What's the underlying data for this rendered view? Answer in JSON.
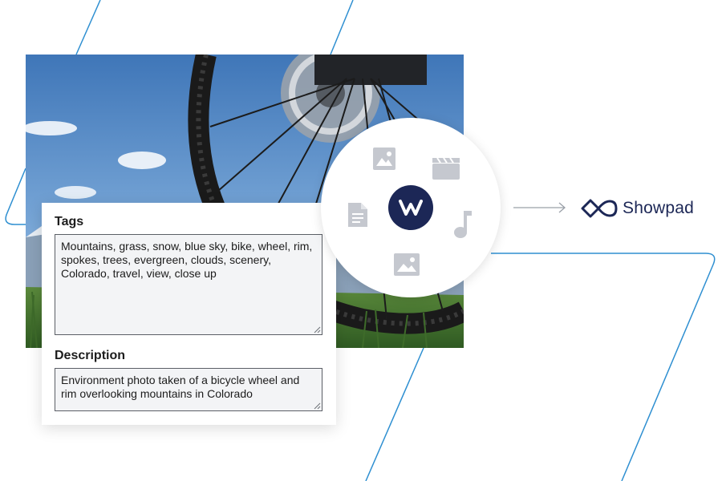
{
  "tags": {
    "label": "Tags",
    "value": "Mountains, grass, snow, blue sky, bike, wheel, rim, spokes, trees, evergreen, clouds, scenery, Colorado, travel, view, close up"
  },
  "description": {
    "label": "Description",
    "value": "Environment photo taken of a bicycle wheel and rim overlooking mountains in Colorado"
  },
  "hub": {
    "icons": [
      "image-icon",
      "video-clapperboard-icon",
      "document-icon",
      "music-note-icon",
      "image-icon"
    ],
    "center_logo": "w-logo-icon"
  },
  "brand": {
    "name": "Showpad",
    "icon": "showpad-logo-icon",
    "color": "#1c2756"
  },
  "colors": {
    "accent_line": "#2e8fd1",
    "icon_gray": "#c5c8cf",
    "navy": "#1c2756"
  }
}
